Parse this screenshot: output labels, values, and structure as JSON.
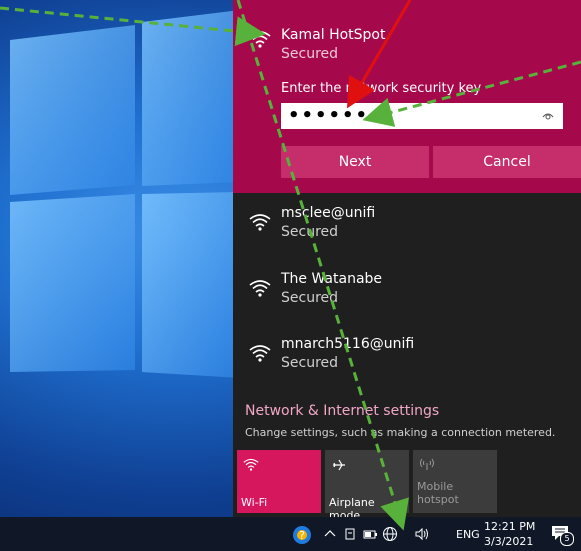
{
  "selected_network": {
    "name": "Kamal HotSpot",
    "status": "Secured",
    "key_label": "Enter the network security key",
    "key_value": "••••••••",
    "next_label": "Next",
    "cancel_label": "Cancel"
  },
  "networks": [
    {
      "name": "msclee@unifi",
      "status": "Secured"
    },
    {
      "name": "The Watanabe",
      "status": "Secured"
    },
    {
      "name": "mnarch5116@unifi",
      "status": "Secured"
    }
  ],
  "settings": {
    "title": "Network & Internet settings",
    "subtitle": "Change settings, such as making a connection metered."
  },
  "tiles": [
    {
      "label": "Wi-Fi",
      "icon": "wifi-icon",
      "state": "on"
    },
    {
      "label": "Airplane mode",
      "icon": "airplane-icon",
      "state": "off"
    },
    {
      "label": "Mobile hotspot",
      "icon": "hotspot-icon",
      "state": "disabled"
    }
  ],
  "taskbar": {
    "language": "ENG",
    "time": "12:21 PM",
    "date": "3/3/2021",
    "notification_count": "5"
  },
  "colors": {
    "accent": "#a6094b",
    "button": "#c62d6b",
    "tile_active": "#d6175e",
    "flyout_bg": "#1f1f1f",
    "annotation_green": "#58b13a",
    "annotation_red": "#e01010"
  }
}
